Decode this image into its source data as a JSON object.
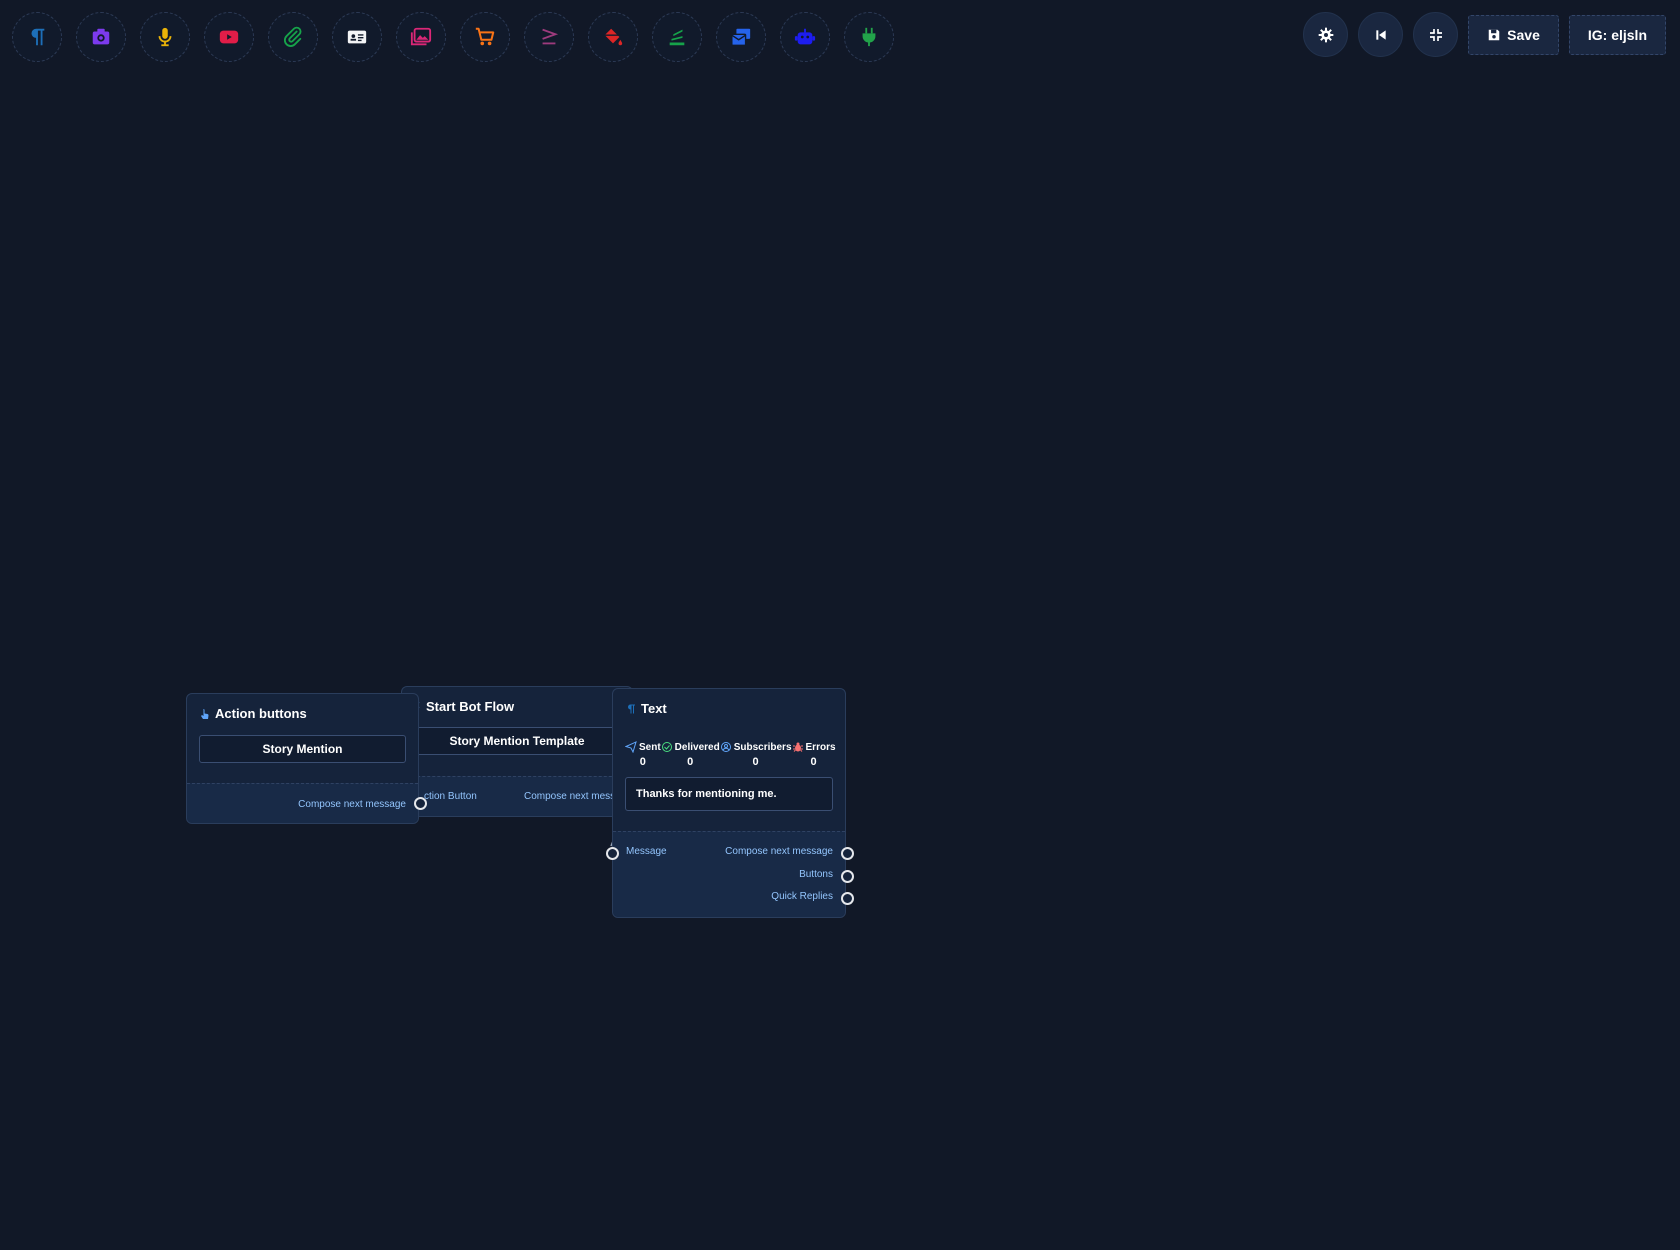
{
  "toolbar": {
    "tools": [
      {
        "name": "paragraph-icon",
        "color": "#1d6fb8"
      },
      {
        "name": "camera-icon",
        "color": "#7c3aed"
      },
      {
        "name": "microphone-icon",
        "color": "#eab308"
      },
      {
        "name": "youtube-icon",
        "color": "#e11d48"
      },
      {
        "name": "paperclip-icon",
        "color": "#16a34a"
      },
      {
        "name": "id-card-icon",
        "color": "#f3f4f6"
      },
      {
        "name": "images-icon",
        "color": "#db2777"
      },
      {
        "name": "cart-icon",
        "color": "#f97316"
      },
      {
        "name": "greater-equal-icon",
        "color": "#9d3b7d"
      },
      {
        "name": "fill-drip-icon",
        "color": "#dc2626"
      },
      {
        "name": "stack-icon",
        "color": "#16a34a"
      },
      {
        "name": "envelopes-icon",
        "color": "#2563eb"
      },
      {
        "name": "robot-icon",
        "color": "#1d1df0"
      },
      {
        "name": "plug-icon",
        "color": "#22a34a"
      }
    ],
    "save_label": "Save",
    "account_label": "IG: eljsln"
  },
  "nodes": {
    "action_buttons": {
      "title": "Action buttons",
      "pill": "Story Mention",
      "out_label": "Compose next message"
    },
    "start_flow": {
      "title": "Start Bot Flow",
      "pill": "Story Mention Template",
      "in_label": "ction Button",
      "out_label": "Compose next messa"
    },
    "text": {
      "title": "Text",
      "stats": [
        {
          "label": "Sent",
          "value": "0",
          "icon": "paper-plane-icon",
          "color": "#60a5fa"
        },
        {
          "label": "Delivered",
          "value": "0",
          "icon": "check-circle-icon",
          "color": "#4ade80"
        },
        {
          "label": "Subscribers",
          "value": "0",
          "icon": "user-circle-icon",
          "color": "#60a5fa"
        },
        {
          "label": "Errors",
          "value": "0",
          "icon": "bug-icon",
          "color": "#f87171"
        }
      ],
      "message": "Thanks for mentioning me.",
      "in_label": "Message",
      "out_compose": "Compose next message",
      "out_buttons": "Buttons",
      "out_quick": "Quick Replies"
    }
  }
}
